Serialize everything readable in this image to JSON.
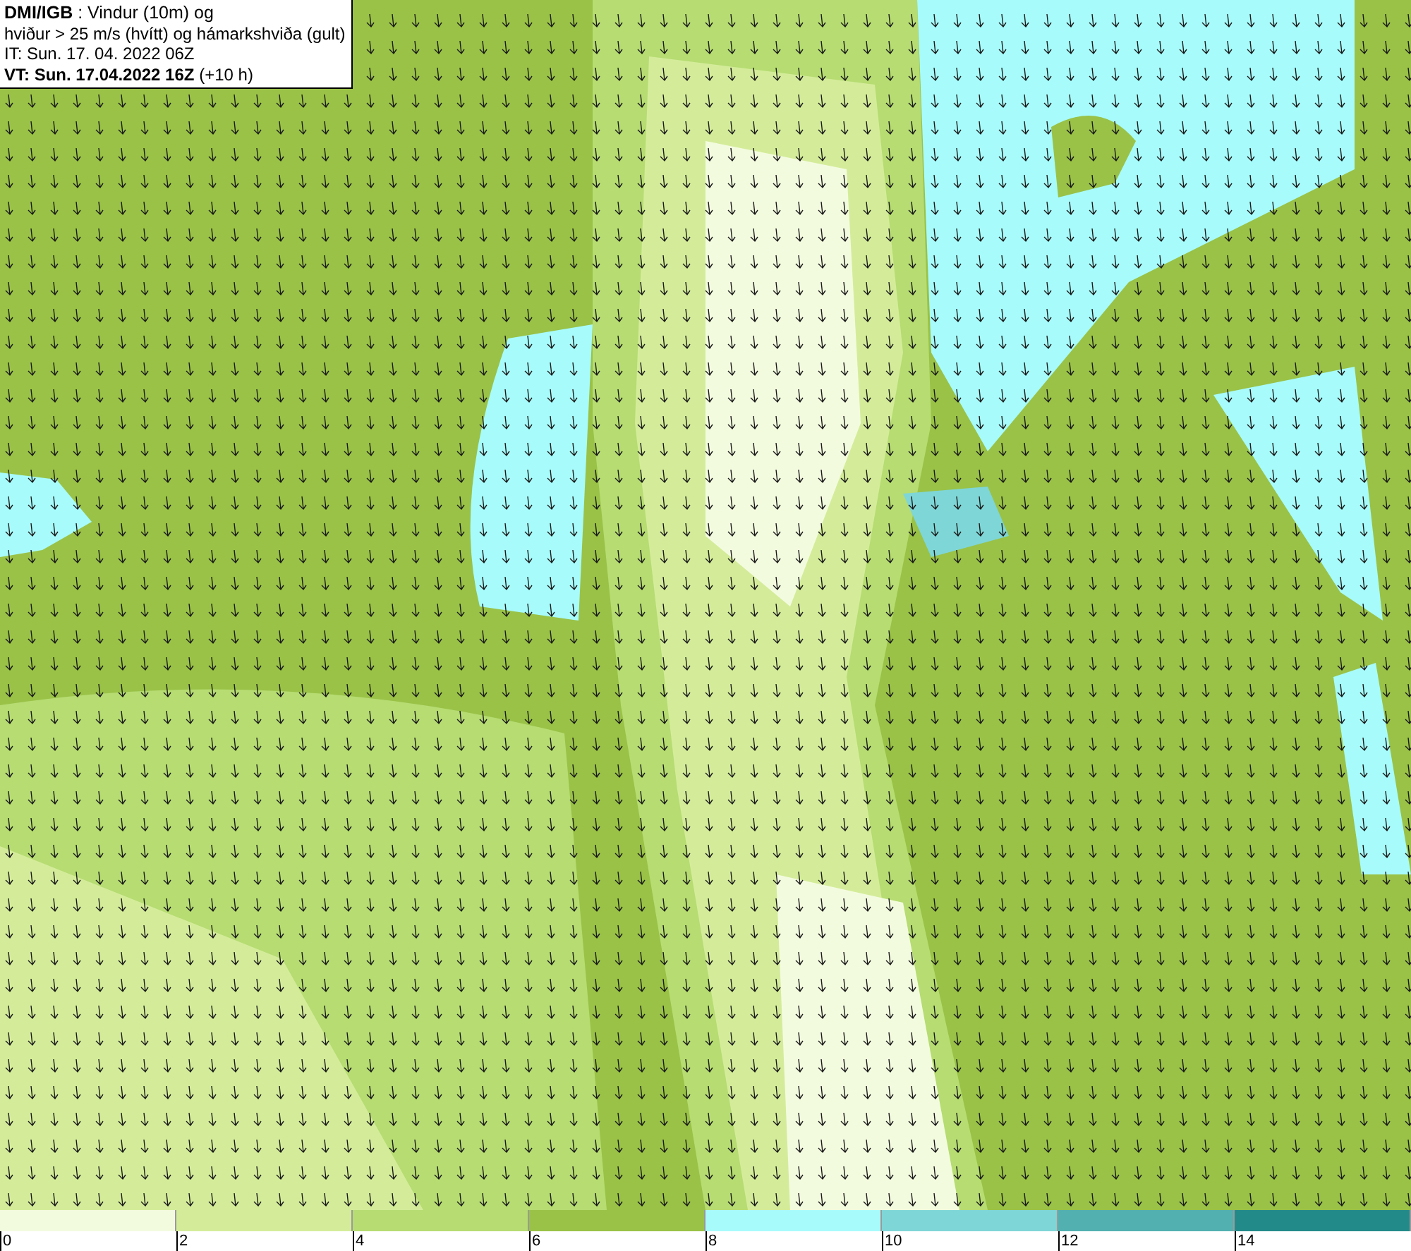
{
  "info_box": {
    "lines": [
      "**DMI/IGB** : Vindur (10m) og",
      "hviður > 25 m/s (hvítt) og hámarkshviða (gult)",
      "IT: Sun. 17. 04. 2022 06Z",
      "**VT: Sun. 17.04.2022 16Z** (+10 h)"
    ]
  },
  "legend": {
    "bins": [
      {
        "color": "#f3fbdf"
      },
      {
        "color": "#d4ec9a"
      },
      {
        "color": "#b6dc72"
      },
      {
        "color": "#99c247"
      },
      {
        "color": "#a8fbfb"
      },
      {
        "color": "#7fd6d6"
      },
      {
        "color": "#52b0b0"
      },
      {
        "color": "#238a8a"
      }
    ],
    "labels": [
      "0",
      "2",
      "4",
      "6",
      "8",
      "10",
      "12",
      "14"
    ]
  }
}
